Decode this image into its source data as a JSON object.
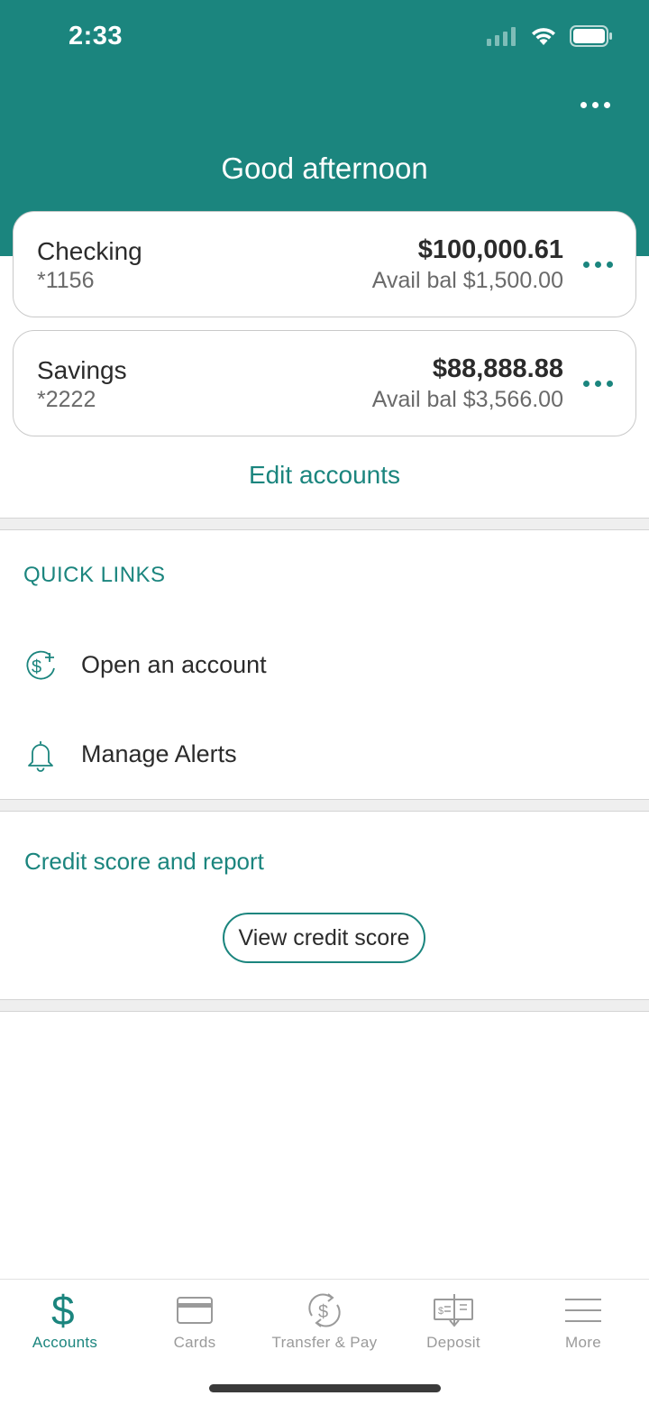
{
  "status_bar": {
    "time": "2:33"
  },
  "header": {
    "greeting": "Good afternoon"
  },
  "accounts": [
    {
      "name": "Checking",
      "number": "*1156",
      "balance": "$100,000.61",
      "available": "Avail bal $1,500.00"
    },
    {
      "name": "Savings",
      "number": "*2222",
      "balance": "$88,888.88",
      "available": "Avail bal $3,566.00"
    }
  ],
  "edit_accounts_label": "Edit accounts",
  "quick_links": {
    "title": "QUICK LINKS",
    "items": [
      {
        "label": "Open an account",
        "icon": "dollar-plus-icon"
      },
      {
        "label": "Manage Alerts",
        "icon": "bell-icon"
      }
    ]
  },
  "credit": {
    "title": "Credit score and report",
    "button_label": "View credit score"
  },
  "tab_bar": {
    "active": "Accounts",
    "tabs": [
      {
        "label": "Accounts",
        "icon": "dollar-icon"
      },
      {
        "label": "Cards",
        "icon": "card-icon"
      },
      {
        "label": "Transfer & Pay",
        "icon": "transfer-icon"
      },
      {
        "label": "Deposit",
        "icon": "check-deposit-icon"
      },
      {
        "label": "More",
        "icon": "menu-icon"
      }
    ]
  },
  "colors": {
    "brand": "#1b857e",
    "text": "#2b2b2b",
    "muted": "#6a6a6a",
    "inactive": "#9a9a9a"
  }
}
